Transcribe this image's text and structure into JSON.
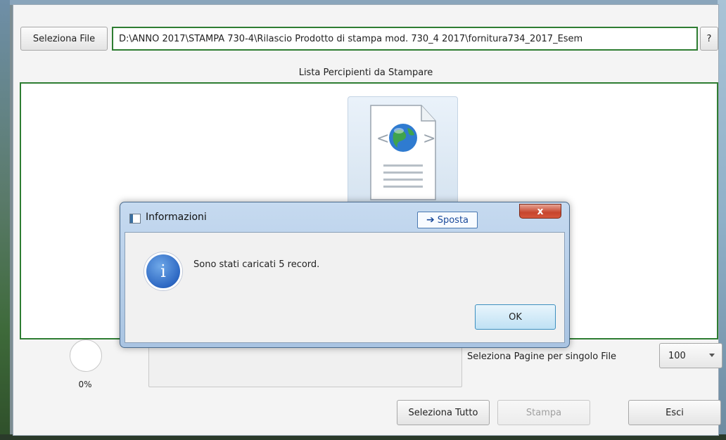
{
  "toolbar": {
    "select_file_label": "Seleziona File",
    "file_path": "D:\\ANNO 2017\\STAMPA  730-4\\Rilascio Prodotto di stampa mod. 730_4 2017\\fornitura734_2017_Esem",
    "help_label": "?"
  },
  "list": {
    "title": "Lista Percipienti da Stampare"
  },
  "progress": {
    "percent_label": "0%",
    "value": 0
  },
  "pages": {
    "label": "Seleziona Pagine per singolo File",
    "selected": "100"
  },
  "actions": {
    "select_all_label": "Seleziona Tutto",
    "print_label": "Stampa",
    "exit_label": "Esci"
  },
  "dialog": {
    "title": "Informazioni",
    "sposta_label": "Sposta",
    "close_label": "x",
    "message": "Sono stati caricati 5 record.",
    "ok_label": "OK",
    "info_icon_glyph": "i"
  },
  "colors": {
    "field_border": "#2e7d32",
    "dialog_frame": "#a9c4e2",
    "close_red": "#c7452d",
    "ok_highlight": "#bfe1f4"
  }
}
